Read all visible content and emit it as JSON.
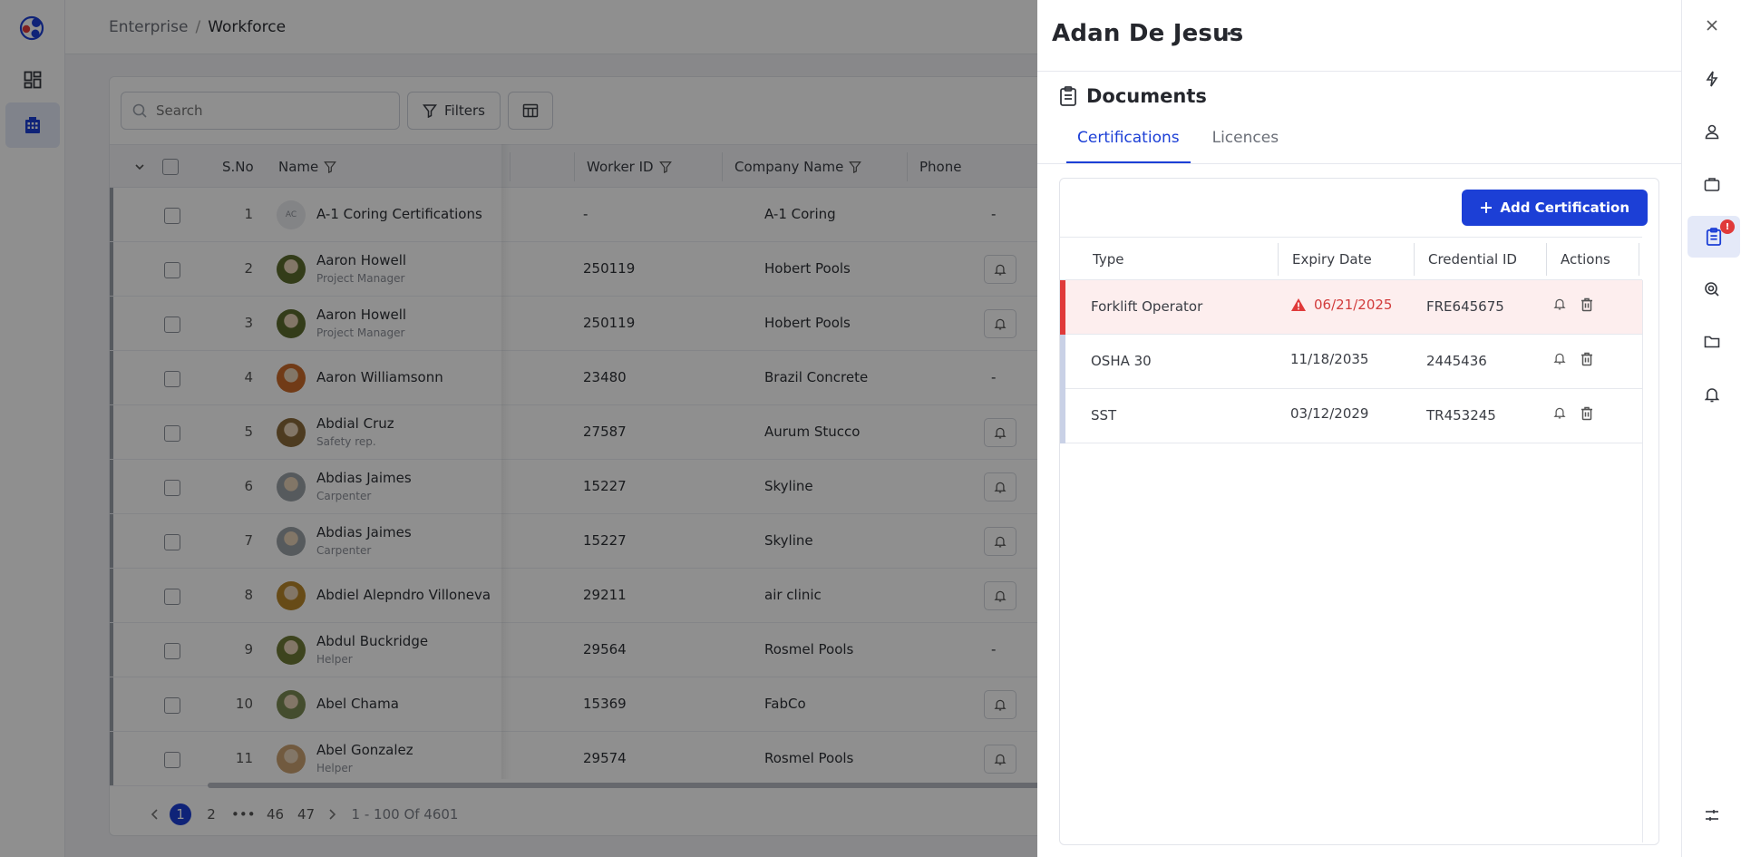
{
  "breadcrumb": {
    "root": "Enterprise",
    "separator": "/",
    "current": "Workforce"
  },
  "toolbar": {
    "search_placeholder": "Search",
    "filters_label": "Filters"
  },
  "table": {
    "columns": {
      "sno": "S.No",
      "name": "Name",
      "worker_id": "Worker ID",
      "company": "Company Name",
      "phone": "Phone"
    },
    "rows": [
      {
        "sno": "1",
        "initials": "AC",
        "name": "A-1 Coring Certifications",
        "role": "",
        "worker_id": "-",
        "company": "A-1 Coring",
        "phone": "-",
        "avatar_color": "#e9ebef"
      },
      {
        "sno": "2",
        "name": "Aaron Howell",
        "role": "Project Manager",
        "worker_id": "250119",
        "company": "Hobert Pools",
        "phone": "bell",
        "avatar_color": "#5b6b2e"
      },
      {
        "sno": "3",
        "name": "Aaron Howell",
        "role": "Project Manager",
        "worker_id": "250119",
        "company": "Hobert Pools",
        "phone": "bell",
        "avatar_color": "#5b6b2e"
      },
      {
        "sno": "4",
        "name": "Aaron Williamsonn",
        "role": "",
        "worker_id": "23480",
        "company": "Brazil Concrete",
        "phone": "-",
        "avatar_color": "#c96a2a"
      },
      {
        "sno": "5",
        "name": "Abdial Cruz",
        "role": "Safety rep.",
        "worker_id": "27587",
        "company": "Aurum Stucco",
        "phone": "bell",
        "avatar_color": "#8a6a3a"
      },
      {
        "sno": "6",
        "name": "Abdias Jaimes",
        "role": "Carpenter",
        "worker_id": "15227",
        "company": "Skyline",
        "phone": "bell",
        "avatar_color": "#9aa0a6"
      },
      {
        "sno": "7",
        "name": "Abdias Jaimes",
        "role": "Carpenter",
        "worker_id": "15227",
        "company": "Skyline",
        "phone": "bell",
        "avatar_color": "#9aa0a6"
      },
      {
        "sno": "8",
        "name": "Abdiel Alepndro Villoneva",
        "role": "",
        "worker_id": "29211",
        "company": "air clinic",
        "phone": "bell",
        "avatar_color": "#b8862a"
      },
      {
        "sno": "9",
        "name": "Abdul Buckridge",
        "role": "Helper",
        "worker_id": "29564",
        "company": "Rosmel Pools",
        "phone": "-",
        "avatar_color": "#6e7a36"
      },
      {
        "sno": "10",
        "name": "Abel Chama",
        "role": "",
        "worker_id": "15369",
        "company": "FabCo",
        "phone": "bell",
        "avatar_color": "#7a8a52"
      },
      {
        "sno": "11",
        "name": "Abel Gonzalez",
        "role": "Helper",
        "worker_id": "29574",
        "company": "Rosmel Pools",
        "phone": "bell",
        "avatar_color": "#c9a070"
      }
    ]
  },
  "pagination": {
    "pages": [
      "1",
      "2",
      "•••",
      "46",
      "47"
    ],
    "current": "1",
    "info": "1 - 100 Of 4601"
  },
  "drawer": {
    "title": "Adan De Jesus",
    "section_title": "Documents",
    "tabs": [
      "Certifications",
      "Licences"
    ],
    "active_tab": "Certifications",
    "add_button": "Add Certification",
    "columns": {
      "type": "Type",
      "expiry": "Expiry Date",
      "credential": "Credential ID",
      "actions": "Actions"
    },
    "certifications": [
      {
        "type": "Forklift Operator",
        "expiry": "06/21/2025",
        "credential": "FRE645675",
        "expired": true,
        "accent": "#e03a3a"
      },
      {
        "type": "OSHA 30",
        "expiry": "11/18/2035",
        "credential": "2445436",
        "expired": false,
        "accent": "#c9d1e6"
      },
      {
        "type": "SST",
        "expiry": "03/12/2029",
        "credential": "TR453245",
        "expired": false,
        "accent": "#c9d1e6"
      }
    ]
  },
  "right_rail": {
    "badge": "!"
  },
  "colors": {
    "accent": "#1c3fd6",
    "danger": "#e03a3a"
  }
}
